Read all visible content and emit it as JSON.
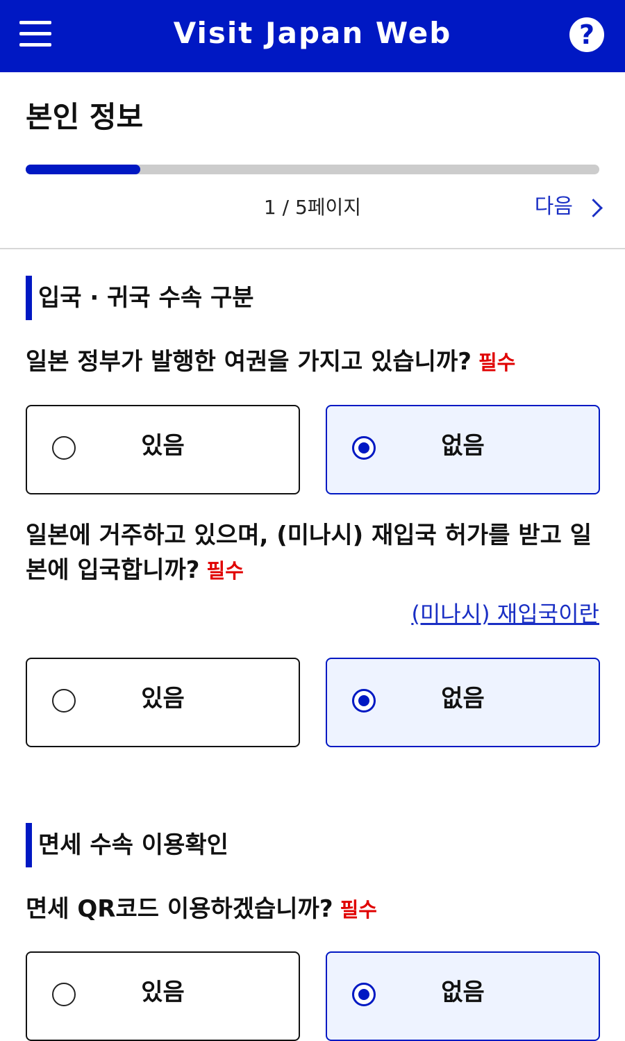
{
  "header": {
    "title": "Visit Japan Web",
    "menu_icon": "hamburger-icon",
    "help_icon": "question-icon",
    "help_label": "?",
    "color": "#0018c3"
  },
  "page": {
    "title": "본인 정보",
    "progress_fraction": 0.2,
    "indicator": "1 / 5페이지",
    "next_label": "다음"
  },
  "sections": [
    {
      "title": "입국 · 귀국 수속 구분",
      "questions": [
        {
          "text": "일본 정부가 발행한 여권을 가지고 있습니까?",
          "required": "필수",
          "options": [
            {
              "label": "있음",
              "selected": false
            },
            {
              "label": "없음",
              "selected": true
            }
          ]
        },
        {
          "text_line1": "일본에 거주하고 있으며, (미나시) 재입국 허가를 받고 일",
          "text_line2": "본에 입국합니까?",
          "required": "필수",
          "link": "(미나시) 재입국이란",
          "options": [
            {
              "label": "있음",
              "selected": false
            },
            {
              "label": "없음",
              "selected": true
            }
          ]
        }
      ]
    },
    {
      "title": "면세 수속 이용확인",
      "questions": [
        {
          "text": "면세 QR코드 이용하겠습니까?",
          "required": "필수",
          "options": [
            {
              "label": "있음",
              "selected": false
            },
            {
              "label": "없음",
              "selected": true
            }
          ]
        }
      ]
    }
  ]
}
